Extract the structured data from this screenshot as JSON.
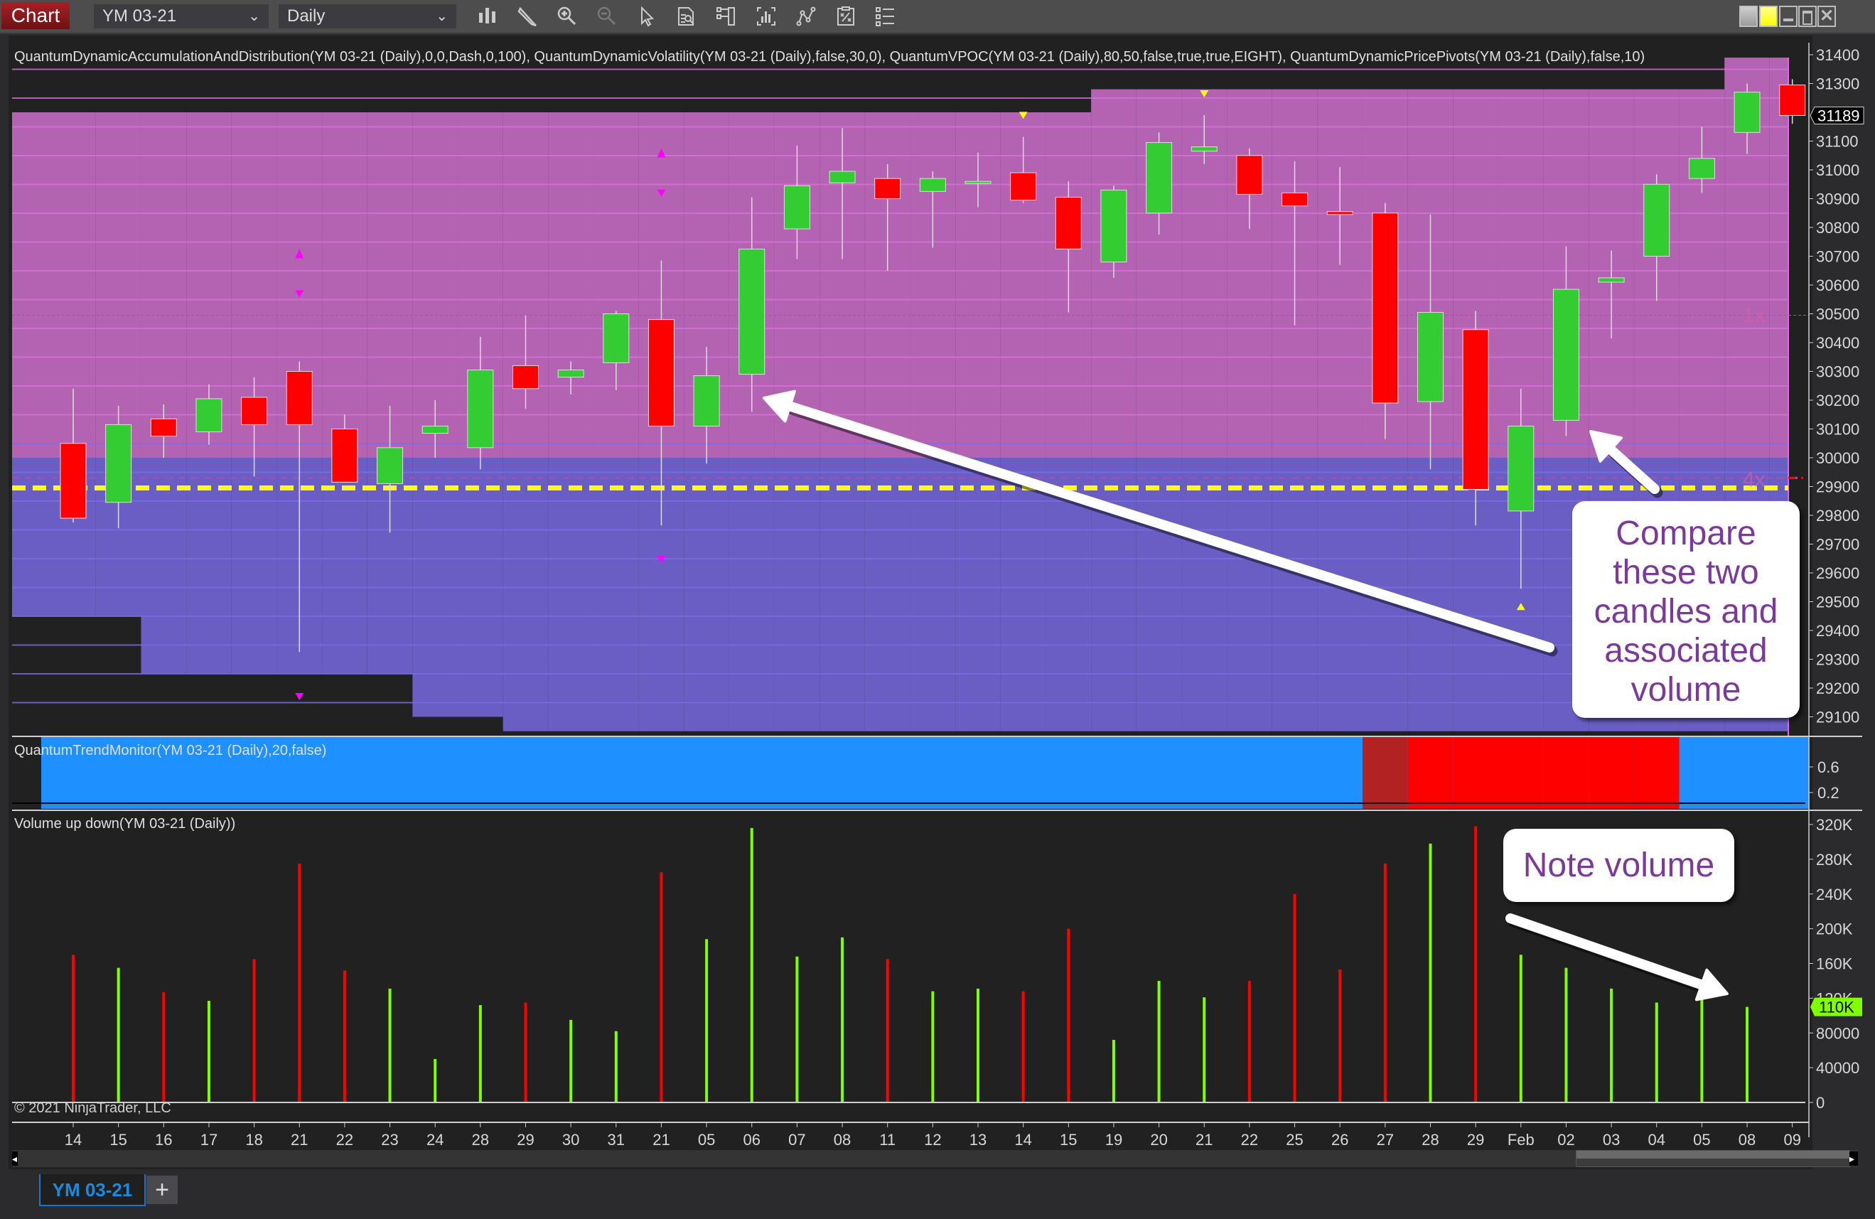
{
  "toolbar": {
    "chart_tab": "Chart",
    "instrument": "YM 03-21",
    "interval": "Daily",
    "tools": [
      "bar-type-icon",
      "drawing-tools-icon",
      "zoom-in-icon",
      "zoom-out-icon",
      "pointer-icon",
      "data-box-icon",
      "chart-properties-icon",
      "indicators-icon",
      "strategies-icon",
      "templates-icon",
      "object-list-icon"
    ],
    "window_buttons": [
      "link-gray-icon",
      "link-yellow-icon",
      "minimize-icon",
      "maximize-icon",
      "close-icon"
    ]
  },
  "colors": {
    "up_candle": "#33cc33",
    "down_candle": "#ff0000",
    "distribution_zone": "#b462b2",
    "accumulation_zone": "#6a5ec4",
    "vpoc_line": "#ffff00",
    "volume_up": "#7fff00",
    "volume_down": "#ff0000",
    "trend_up": "#1e90ff",
    "trend_down": "#ff0000",
    "trend_transition": "#b22222",
    "annotation_text": "#7b3a9a"
  },
  "chart_data": [
    {
      "type": "candlestick",
      "panel": "price",
      "indicator_label": "QuantumDynamicAccumulationAndDistribution(YM 03-21 (Daily),0,0,Dash,0,100), QuantumDynamicVolatility(YM 03-21 (Daily),false,30,0), QuantumVPOC(YM 03-21 (Daily),80,50,false,true,true,EIGHT), QuantumDynamicPricePivots(YM 03-21 (Daily),false,10)",
      "ylim": [
        29050,
        31450
      ],
      "yticks": [
        31400,
        31300,
        31100,
        31000,
        30900,
        30800,
        30700,
        30600,
        30500,
        30400,
        30300,
        30200,
        30100,
        30000,
        29900,
        29800,
        29700,
        29600,
        29500,
        29400,
        29300,
        29200,
        29100
      ],
      "last_price": 31189,
      "vpoc_level": 29895,
      "zone_boundary": 30000,
      "volatility_labels": [
        {
          "text": "1x",
          "price": 30500
        },
        {
          "text": "4x",
          "price": 29930
        }
      ],
      "categories": [
        "14",
        "15",
        "16",
        "17",
        "18",
        "21",
        "22",
        "23",
        "24",
        "28",
        "29",
        "30",
        "31",
        "21",
        "05",
        "06",
        "07",
        "08",
        "11",
        "12",
        "13",
        "14",
        "15",
        "19",
        "20",
        "21",
        "22",
        "25",
        "26",
        "27",
        "28",
        "29",
        "Feb",
        "02",
        "03",
        "04",
        "05",
        "08",
        "09"
      ],
      "ohlc": [
        [
          30050,
          30240,
          29775,
          29790
        ],
        [
          29845,
          30180,
          29755,
          30115
        ],
        [
          30135,
          30185,
          30000,
          30075
        ],
        [
          30090,
          30255,
          30045,
          30205
        ],
        [
          30210,
          30280,
          29935,
          30115
        ],
        [
          30300,
          30335,
          29325,
          30115
        ],
        [
          30100,
          30150,
          29915,
          29915
        ],
        [
          29910,
          30180,
          29740,
          30035
        ],
        [
          30085,
          30200,
          30000,
          30110
        ],
        [
          30035,
          30420,
          29960,
          30305
        ],
        [
          30320,
          30495,
          30170,
          30240
        ],
        [
          30280,
          30335,
          30220,
          30305
        ],
        [
          30330,
          30510,
          30235,
          30500
        ],
        [
          30480,
          30685,
          29765,
          30110
        ],
        [
          30110,
          30385,
          29980,
          30285
        ],
        [
          30290,
          30905,
          30160,
          30725
        ],
        [
          30795,
          31085,
          30690,
          30945
        ],
        [
          30955,
          31145,
          30690,
          30995
        ],
        [
          30970,
          31020,
          30650,
          30900
        ],
        [
          30925,
          30995,
          30730,
          30970
        ],
        [
          30960,
          31060,
          30870,
          30960
        ],
        [
          30990,
          31115,
          30885,
          30895
        ],
        [
          30905,
          30960,
          30505,
          30725
        ],
        [
          30680,
          30945,
          30625,
          30930
        ],
        [
          30850,
          31130,
          30775,
          31095
        ],
        [
          31065,
          31190,
          31020,
          31080
        ],
        [
          31050,
          31075,
          30795,
          30915
        ],
        [
          30920,
          31030,
          30460,
          30875
        ],
        [
          30855,
          31010,
          30670,
          30845
        ],
        [
          30850,
          30885,
          30065,
          30190
        ],
        [
          30195,
          30845,
          29960,
          30505
        ],
        [
          30445,
          30510,
          29765,
          29890
        ],
        [
          29815,
          30240,
          29545,
          30110
        ],
        [
          30130,
          30735,
          30075,
          30585
        ],
        [
          30610,
          30720,
          30415,
          30625
        ],
        [
          30700,
          30985,
          30545,
          30950
        ],
        [
          30970,
          31150,
          30920,
          31040
        ],
        [
          31130,
          31300,
          31055,
          31270
        ],
        [
          31295,
          31315,
          31160,
          31189
        ]
      ],
      "pivots": [
        {
          "index": 5,
          "type": "high",
          "color": "#ff00ff"
        },
        {
          "index": 5,
          "type": "low",
          "color": "#ff00ff"
        },
        {
          "index": 13,
          "type": "high",
          "color": "#ff00ff"
        },
        {
          "index": 13,
          "type": "low",
          "color": "#ff00ff"
        },
        {
          "index": 21,
          "type": "high",
          "color": "#ffff00"
        },
        {
          "index": 25,
          "type": "high",
          "color": "#ffff00"
        },
        {
          "index": 32,
          "type": "low",
          "color": "#ffff00"
        }
      ],
      "zones": {
        "distribution_tops": [
          31200,
          31200,
          31200,
          31200,
          31200,
          31200,
          31200,
          31200,
          31200,
          31200,
          31200,
          31200,
          31200,
          31200,
          31200,
          31200,
          31200,
          31200,
          31200,
          31200,
          31200,
          31200,
          31200,
          31280,
          31280,
          31280,
          31280,
          31280,
          31280,
          31280,
          31280,
          31280,
          31280,
          31280,
          31280,
          31280,
          31280,
          31390,
          31390
        ],
        "accumulation_bottoms": [
          29450,
          29450,
          29250,
          29250,
          29250,
          29250,
          29250,
          29250,
          29100,
          29100,
          29050,
          29050,
          29050,
          29050,
          29050,
          29050,
          29050,
          29050,
          29050,
          29050,
          29050,
          29050,
          29050,
          29050,
          29050,
          29050,
          29050,
          29050,
          29050,
          29050,
          29050,
          29050,
          29050,
          29050,
          29050,
          29050,
          29050,
          29050,
          29050
        ]
      }
    },
    {
      "type": "heatmap",
      "panel": "trend",
      "indicator_label": "QuantumTrendMonitor(YM 03-21 (Daily),20,false)",
      "yticks": [
        0.6,
        0.2
      ],
      "states": [
        "up",
        "up",
        "up",
        "up",
        "up",
        "up",
        "up",
        "up",
        "up",
        "up",
        "up",
        "up",
        "up",
        "up",
        "up",
        "up",
        "up",
        "up",
        "up",
        "up",
        "up",
        "up",
        "up",
        "up",
        "up",
        "up",
        "up",
        "up",
        "up",
        "transition",
        "down",
        "down",
        "down",
        "down",
        "down",
        "down",
        "up",
        "up",
        "up"
      ]
    },
    {
      "type": "bar",
      "panel": "volume",
      "indicator_label": "Volume up down(YM 03-21 (Daily))",
      "ylim": [
        0,
        330000
      ],
      "ytick_labels": [
        "320K",
        "280K",
        "240K",
        "200K",
        "160K",
        "120K",
        "80000",
        "40000",
        "0"
      ],
      "yticks": [
        320000,
        280000,
        240000,
        200000,
        160000,
        120000,
        80000,
        40000,
        0
      ],
      "last_volume_label": "110K",
      "values": [
        170000,
        155000,
        127000,
        117000,
        165000,
        275000,
        152000,
        131000,
        50000,
        112000,
        115000,
        95000,
        82000,
        265000,
        188000,
        316000,
        168000,
        190000,
        165000,
        128000,
        131000,
        128000,
        200000,
        72000,
        140000,
        121000,
        140000,
        240000,
        153000,
        275000,
        298000,
        318000,
        170000,
        155000,
        131000,
        115000,
        120000,
        110000,
        0
      ],
      "directions": [
        "down",
        "up",
        "down",
        "up",
        "down",
        "down",
        "down",
        "up",
        "up",
        "up",
        "down",
        "up",
        "up",
        "down",
        "up",
        "up",
        "up",
        "up",
        "down",
        "up",
        "up",
        "down",
        "down",
        "up",
        "up",
        "up",
        "down",
        "down",
        "down",
        "down",
        "up",
        "down",
        "up",
        "up",
        "up",
        "up",
        "up",
        "up",
        "down"
      ]
    }
  ],
  "copyright": "© 2021 NinjaTrader, LLC",
  "annotations": {
    "compare_note": "Compare these two candles and associated volume",
    "volume_note": "Note volume"
  },
  "bottom_tabs": {
    "active": "YM 03-21",
    "add_label": "+"
  }
}
